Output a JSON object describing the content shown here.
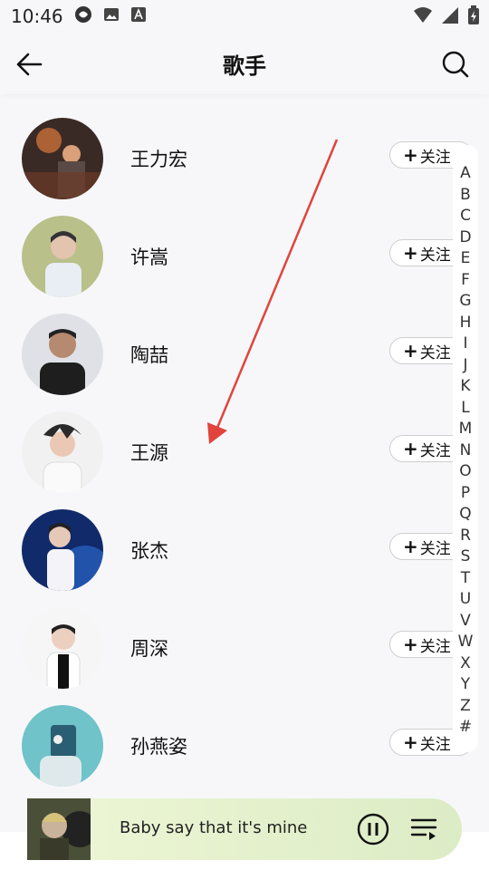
{
  "status_bar": {
    "time": "10:46"
  },
  "header": {
    "title": "歌手"
  },
  "follow_label": "关注",
  "singers": [
    {
      "name": "王力宏"
    },
    {
      "name": "许嵩"
    },
    {
      "name": "陶喆"
    },
    {
      "name": "王源"
    },
    {
      "name": "张杰"
    },
    {
      "name": "周深"
    },
    {
      "name": "孙燕姿"
    }
  ],
  "index_letters": [
    "A",
    "B",
    "C",
    "D",
    "E",
    "F",
    "G",
    "H",
    "I",
    "J",
    "K",
    "L",
    "M",
    "N",
    "O",
    "P",
    "Q",
    "R",
    "S",
    "T",
    "U",
    "V",
    "W",
    "X",
    "Y",
    "Z",
    "#"
  ],
  "player": {
    "track": "Baby say that it's mine"
  },
  "colors": {
    "annotation_arrow": "#e0443c",
    "player_bg_start": "#eef6d6",
    "player_bg_end": "#dcecc5"
  }
}
